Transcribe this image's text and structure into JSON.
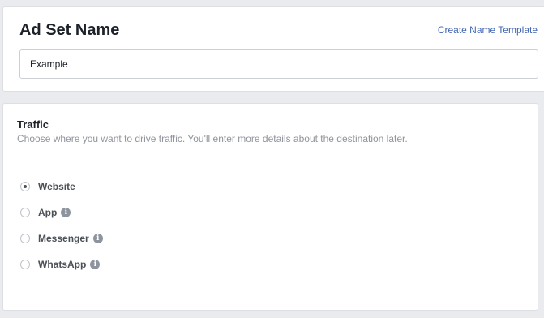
{
  "adset": {
    "title": "Ad Set Name",
    "template_link": "Create Name Template",
    "name_value": "Example"
  },
  "traffic": {
    "title": "Traffic",
    "description": "Choose where you want to drive traffic. You'll enter more details about the destination later.",
    "options": [
      {
        "label": "Website",
        "selected": true,
        "has_info": false
      },
      {
        "label": "App",
        "selected": false,
        "has_info": true
      },
      {
        "label": "Messenger",
        "selected": false,
        "has_info": true
      },
      {
        "label": "WhatsApp",
        "selected": false,
        "has_info": true
      }
    ],
    "info_glyph": "i"
  }
}
